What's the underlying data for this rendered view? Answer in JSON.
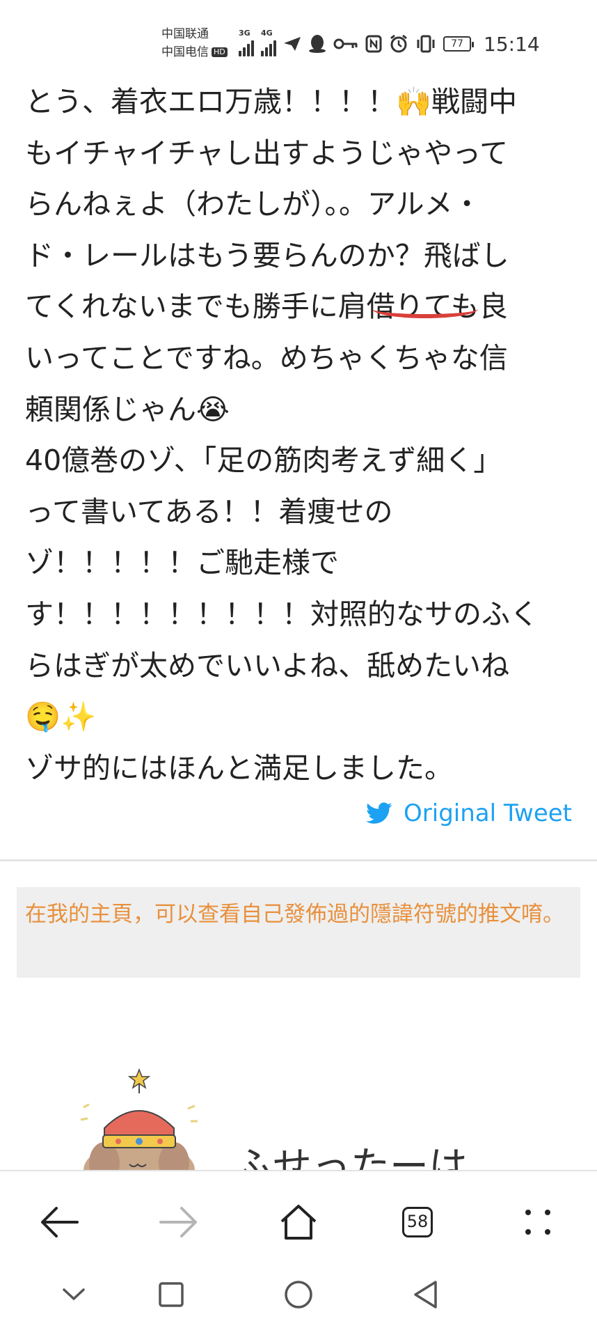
{
  "status_bar": {
    "carrier_1": "中国联通",
    "carrier_2": "中国电信",
    "hd_badge": "HD",
    "net_1": "3G",
    "net_2": "4G",
    "battery": "77",
    "time": "15:14"
  },
  "tweet": {
    "lines": [
      "とう、着衣エロ万歳！！！！🙌戦闘中",
      "もイチャイチャし出すようじゃやって",
      "らんねぇよ（わたしが）。。アルメ・",
      "ド・レールはもう要らんのか？飛ばし",
      "てくれないまでも勝手に肩借りても良",
      "いってことですね。めちゃくちゃな信",
      "頼関係じゃん😭",
      "40億巻のゾ、「足の筋肉考えず細く」",
      "って書いてある！！着痩せの",
      "ゾ！！！！！ご馳走様で",
      "す！！！！！！！！！対照的なサのふく",
      "らはぎが太めでいいよね、舐めたいね",
      "🤤✨",
      "ゾサ的にはほんと満足しました。"
    ],
    "original_link": "Original Tweet"
  },
  "notice": {
    "text": "在我的主頁，可以查看自己發佈過的隱諱符號的推文唷。"
  },
  "brand": {
    "partial_title": "ふせったーは"
  },
  "toolbar": {
    "tab_count": "58"
  },
  "colors": {
    "link": "#1da1f2",
    "notice_text": "#e8903c",
    "notice_bg": "#efefef",
    "underline": "#d9403a"
  }
}
